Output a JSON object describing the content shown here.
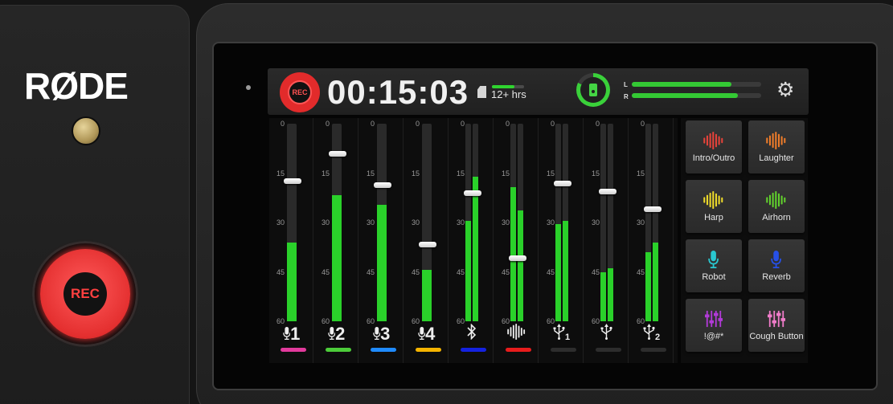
{
  "hardware": {
    "brand": "RØDE",
    "rec_button_label": "REC"
  },
  "topbar": {
    "rec_label": "REC",
    "timer": "00:15:03",
    "storage_text": "12+ hrs",
    "storage_level": 0.7,
    "output_level": 0.82,
    "left_label": "L",
    "right_label": "R",
    "left_level": 0.77,
    "right_level": 0.82,
    "settings_icon": "gear-icon"
  },
  "mixer": {
    "scale": [
      "0",
      "15",
      "30",
      "45",
      "60"
    ],
    "channels": [
      {
        "id": "mic-1",
        "icon": "mic-icon",
        "number": "1",
        "color": "#e23a9c",
        "fader": 0.29,
        "meters": [
          0.4
        ]
      },
      {
        "id": "mic-2",
        "icon": "mic-icon",
        "number": "2",
        "color": "#4ccc3a",
        "fader": 0.15,
        "meters": [
          0.64
        ]
      },
      {
        "id": "mic-3",
        "icon": "mic-icon",
        "number": "3",
        "color": "#1f8bff",
        "fader": 0.31,
        "meters": [
          0.59
        ]
      },
      {
        "id": "mic-4",
        "icon": "mic-icon",
        "number": "4",
        "color": "#f5b400",
        "fader": 0.61,
        "meters": [
          0.26
        ]
      },
      {
        "id": "bluetooth",
        "icon": "bluetooth-icon",
        "number": "",
        "color": "#1422e0",
        "fader": 0.35,
        "meters": [
          0.51,
          0.73
        ]
      },
      {
        "id": "sound-pads",
        "icon": "waveform-icon",
        "number": "",
        "color": "#e81c1c",
        "fader": 0.68,
        "meters": [
          0.68,
          0.56
        ]
      },
      {
        "id": "usb-1",
        "icon": "usb-icon",
        "number": "1",
        "color": "#2d2d2d",
        "fader": 0.3,
        "meters": [
          0.49,
          0.51
        ]
      },
      {
        "id": "usb-chat",
        "icon": "usb-icon",
        "number": "",
        "color": "#2d2d2d",
        "fader": 0.34,
        "meters": [
          0.25,
          0.27
        ]
      },
      {
        "id": "usb-2",
        "icon": "usb-icon",
        "number": "2",
        "color": "#2d2d2d",
        "fader": 0.43,
        "meters": [
          0.35,
          0.4
        ]
      }
    ]
  },
  "pads": [
    {
      "label": "Intro/Outro",
      "icon": "waveform-icon",
      "color": "#e8433a"
    },
    {
      "label": "Laughter",
      "icon": "waveform-icon",
      "color": "#f07d2a"
    },
    {
      "label": "Harp",
      "icon": "waveform-icon",
      "color": "#f0dc2a"
    },
    {
      "label": "Airhorn",
      "icon": "waveform-icon",
      "color": "#62d32c"
    },
    {
      "label": "Robot",
      "icon": "mic-icon",
      "color": "#29c7d0"
    },
    {
      "label": "Reverb",
      "icon": "mic-icon",
      "color": "#2650e8"
    },
    {
      "label": "!@#*",
      "icon": "sliders-icon",
      "color": "#b23ad8"
    },
    {
      "label": "Cough Button",
      "icon": "sliders-icon",
      "color": "#f07cc9"
    }
  ]
}
